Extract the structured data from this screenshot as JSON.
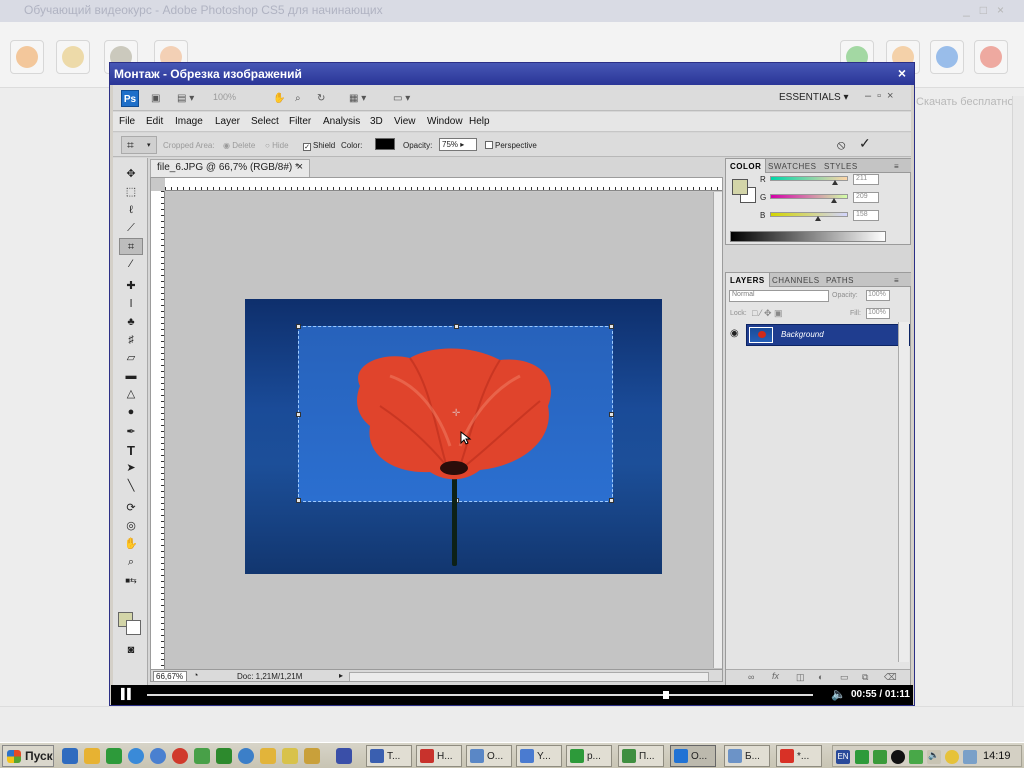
{
  "background_app": {
    "title": "Обучающий видеокурс - Adobe Photoshop CS5 для начинающих",
    "right_link": "Скачать бесплатно"
  },
  "dialog": {
    "title": "Монтаж - Обрезка изображений",
    "close_glyph": "×"
  },
  "photoshop": {
    "logo": "Ps",
    "zoom_combo": "100%",
    "workspace": "ESSENTIALS",
    "menus": [
      "File",
      "Edit",
      "Image",
      "Layer",
      "Select",
      "Filter",
      "Analysis",
      "3D",
      "View",
      "Window",
      "Help"
    ],
    "options": {
      "cropped_area_label": "Cropped Area:",
      "delete_label": "Delete",
      "hide_label": "Hide",
      "shield_label": "Shield",
      "color_label": "Color:",
      "opacity_label": "Opacity:",
      "opacity_value": "75%",
      "perspective_label": "Perspective"
    },
    "document": {
      "tab_title": "file_6.JPG @ 66,7% (RGB/8#) *",
      "zoom": "66,67%",
      "doc_size": "Doc: 1,21M/1,21M",
      "ruler_numbers": [
        "10",
        "5",
        "0",
        "5",
        "10",
        "15",
        "20",
        "25",
        "30",
        "35",
        "40",
        "45",
        "50",
        "55",
        "60",
        "65",
        "70"
      ]
    },
    "color_panel": {
      "tabs": [
        "COLOR",
        "SWATCHES",
        "STYLES"
      ],
      "foreground": "#d3d5a8",
      "channels": [
        {
          "label": "R",
          "value": "211",
          "fraction": 0.83
        },
        {
          "label": "G",
          "value": "209",
          "fraction": 0.82
        },
        {
          "label": "B",
          "value": "158",
          "fraction": 0.62
        }
      ]
    },
    "layers_panel": {
      "tabs": [
        "LAYERS",
        "CHANNELS",
        "PATHS"
      ],
      "blend_mode": "Normal",
      "opacity_label": "Opacity:",
      "opacity_value": "100%",
      "lock_label": "Lock:",
      "fill_label": "Fill:",
      "fill_value": "100%",
      "layer_name": "Background"
    }
  },
  "video": {
    "progress": 0.78,
    "time": "00:55 / 01:11"
  },
  "taskbar": {
    "start_label": "Пуск",
    "tasks": [
      {
        "label": "Т...",
        "color": "#3a5fb0"
      },
      {
        "label": "Н...",
        "color": "#c8322c"
      },
      {
        "label": "О...",
        "color": "#5a87c6"
      },
      {
        "label": "Y...",
        "color": "#4a7bd0"
      },
      {
        "label": "р...",
        "color": "#2d9a3a"
      },
      {
        "label": "П...",
        "color": "#3f8f40"
      },
      {
        "label": "О...",
        "color": "#2072d4",
        "active": true
      },
      {
        "label": "Б...",
        "color": "#6c93c7"
      },
      {
        "label": "*...",
        "color": "#d83126"
      }
    ],
    "clock": "14:19"
  }
}
